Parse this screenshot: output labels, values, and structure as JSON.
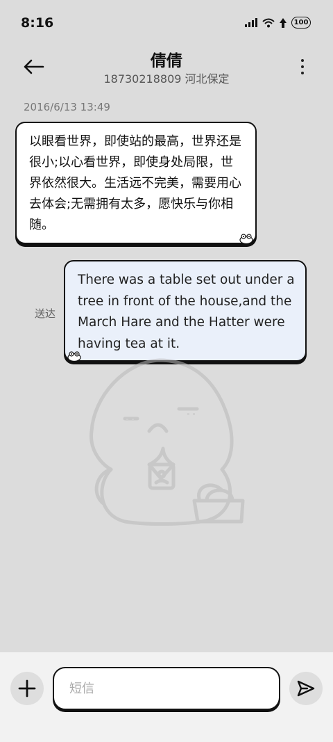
{
  "status_bar": {
    "time": "8:16",
    "battery": "100",
    "icons": [
      "signal-icon",
      "wifi-icon",
      "data-icon",
      "battery-icon"
    ]
  },
  "header": {
    "contact_name": "倩倩",
    "contact_info": "18730218809 河北保定",
    "icons": [
      "back-arrow-icon",
      "more-vertical-icon"
    ]
  },
  "conversation": {
    "timestamp": "2016/6/13 13:49",
    "incoming_message": "以眼看世界，即使站的最高，世界还是很小;以心看世界，即使身处局限，世界依然很大。生活远不完美，需要用心去体会;无需拥有太多，愿快乐与你相随。",
    "outgoing_message": "There was a table set out under a tree in front of the house,and the March Hare and the Hatter were having tea at it.",
    "outgoing_status": "送达"
  },
  "composer": {
    "placeholder": "短信",
    "value": "",
    "icons": [
      "plus-icon",
      "send-icon"
    ]
  },
  "colors": {
    "background": "#dcdcdc",
    "incoming_bubble": "#ffffff",
    "outgoing_bubble": "#eaf0fa",
    "outline": "#111111",
    "input_area": "#f2f2f2"
  }
}
